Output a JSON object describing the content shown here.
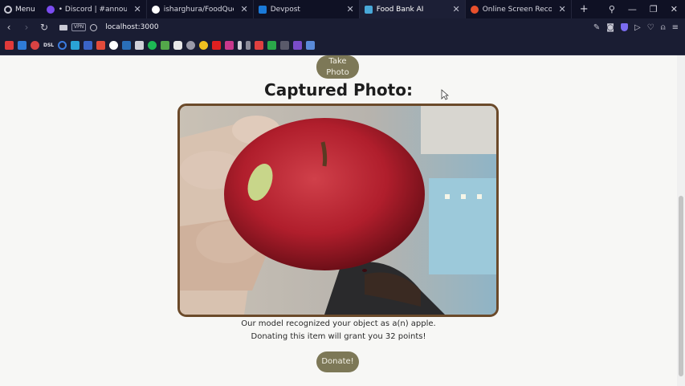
{
  "browser": {
    "menu_label": "Menu",
    "tabs": [
      {
        "label": "• Discord | #announceme…",
        "favicon_color": "#7b4cf0"
      },
      {
        "label": "isharghura/FoodQuest",
        "favicon_color": "#ffffff"
      },
      {
        "label": "Devpost",
        "favicon_color": "#1a7ad9"
      },
      {
        "label": "Food Bank AI",
        "favicon_color": "#48a8d8"
      },
      {
        "label": "Online Screen Recorder",
        "favicon_color": "#e8502c"
      }
    ],
    "active_tab_index": 3,
    "new_tab_label": "+",
    "url": "localhost:3000",
    "vpn_label": "VPN"
  },
  "page": {
    "take_photo_label": "Take Photo",
    "heading": "Captured Photo:",
    "caption_line1": "Our model recognized your object as a(n) apple.",
    "caption_line2": "Donating this item will grant you 32 points!",
    "donate_label": "Donate!"
  },
  "colors": {
    "button_bg": "#7d7857",
    "photo_border": "#6b4a2a",
    "browser_bg": "#0f1124"
  }
}
